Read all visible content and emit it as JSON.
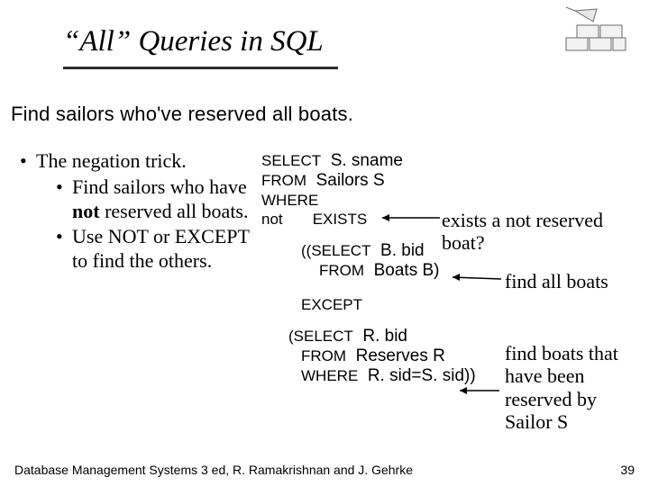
{
  "title": "“All” Queries in SQL",
  "subtitle": "Find sailors who've  reserved all boats.",
  "bullets": {
    "b1": "The negation trick.",
    "b1a_pre": "Find sailors who have ",
    "b1a_bold": "not",
    "b1a_post": " reserved all boats.",
    "b1b": "Use NOT or EXCEPT to find the others."
  },
  "sql": {
    "l1_kw": "SELECT",
    "l1_arg": "  S. sname",
    "l2_kw": "FROM",
    "l2_arg": "  Sailors S",
    "l3_kw": "WHERE",
    "l4_pre": "not       ",
    "l4_kw": "EXISTS",
    "l5_pre": "((",
    "l5_kw": "SELECT",
    "l5_arg": "  B. bid",
    "l6_kw": "FROM",
    "l6_arg": "  Boats B)",
    "l7_kw": "EXCEPT",
    "l8_pre": "(",
    "l8_kw": "SELECT",
    "l8_arg": "  R. bid",
    "l9_kw": "FROM",
    "l9_arg": "  Reserves R",
    "l10_kw": "WHERE",
    "l10_arg": "  R. sid=S. sid))"
  },
  "annotations": {
    "a1": "exists a not reserved boat?",
    "a2": "find all boats",
    "a3": "find boats that have been reserved by Sailor S"
  },
  "footer": "Database Management Systems 3 ed,  R. Ramakrishnan and J. Gehrke",
  "page": "39"
}
